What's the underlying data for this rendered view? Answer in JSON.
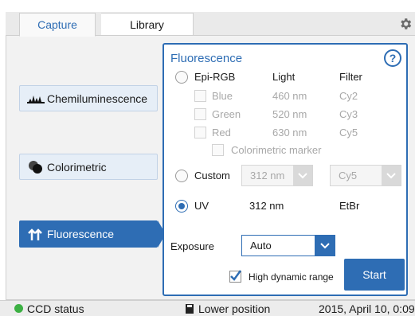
{
  "tabs": {
    "capture": "Capture",
    "library": "Library"
  },
  "icons": {
    "settings": "gear-icon"
  },
  "modes": {
    "chemi": "Chemiluminescence",
    "colorimetric": "Colorimetric",
    "fluorescence": "Fluorescence"
  },
  "panel": {
    "title": "Fluorescence",
    "help": "?",
    "epi_label": "Epi-RGB",
    "col_light": "Light",
    "col_filter": "Filter",
    "channels": [
      {
        "name": "Blue",
        "light": "460 nm",
        "filter": "Cy2"
      },
      {
        "name": "Green",
        "light": "520 nm",
        "filter": "Cy3"
      },
      {
        "name": "Red",
        "light": "630 nm",
        "filter": "Cy5"
      }
    ],
    "colorimetric_marker": "Colorimetric marker",
    "custom_label": "Custom",
    "custom_light": "312 nm",
    "custom_filter": "Cy5",
    "uv_label": "UV",
    "uv_light": "312 nm",
    "uv_filter": "EtBr",
    "exposure_label": "Exposure",
    "exposure_value": "Auto",
    "hdr_label": "High dynamic range",
    "hdr_checked": true,
    "start": "Start"
  },
  "status": {
    "ccd": "CCD status",
    "position": "Lower position",
    "datetime": "2015, April 10, 0:09"
  },
  "colors": {
    "accent": "#2e6db4",
    "status_ok": "#3cb043"
  }
}
